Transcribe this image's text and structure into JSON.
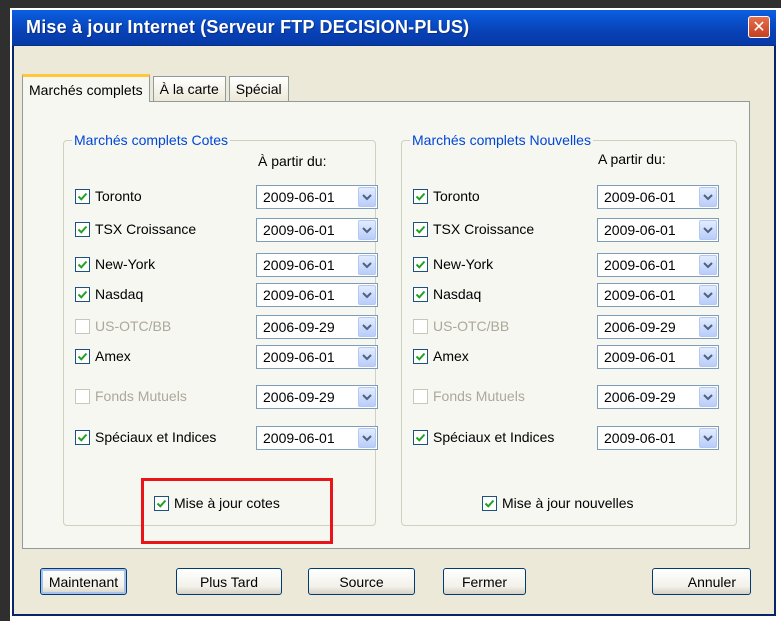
{
  "window": {
    "title": "Mise à jour Internet (Serveur FTP DECISION-PLUS)",
    "close_glyph": "✕"
  },
  "tabs": [
    {
      "label": "Marchés complets",
      "active": true
    },
    {
      "label": "À la carte",
      "active": false
    },
    {
      "label": "Spécial",
      "active": false
    }
  ],
  "cotes": {
    "group_title": "Marchés complets Cotes",
    "date_header": "À partir du:",
    "rows": [
      {
        "label": "Toronto",
        "checked": true,
        "enabled": true,
        "date": "2009-06-01"
      },
      {
        "label": "TSX Croissance",
        "checked": true,
        "enabled": true,
        "date": "2009-06-01"
      },
      {
        "label": "New-York",
        "checked": true,
        "enabled": true,
        "date": "2009-06-01"
      },
      {
        "label": "Nasdaq",
        "checked": true,
        "enabled": true,
        "date": "2009-06-01"
      },
      {
        "label": "US-OTC/BB",
        "checked": false,
        "enabled": false,
        "date": "2006-09-29"
      },
      {
        "label": "Amex",
        "checked": true,
        "enabled": true,
        "date": "2009-06-01"
      },
      {
        "label": "Fonds Mutuels",
        "checked": false,
        "enabled": false,
        "date": "2006-09-29"
      },
      {
        "label": "Spéciaux et Indices",
        "checked": true,
        "enabled": true,
        "date": "2009-06-01"
      }
    ],
    "update_label": "Mise à jour cotes",
    "update_checked": true
  },
  "nouvelles": {
    "group_title": "Marchés complets Nouvelles",
    "date_header": "A partir du:",
    "rows": [
      {
        "label": "Toronto",
        "checked": true,
        "enabled": true,
        "date": "2009-06-01"
      },
      {
        "label": "TSX Croissance",
        "checked": true,
        "enabled": true,
        "date": "2009-06-01"
      },
      {
        "label": "New-York",
        "checked": true,
        "enabled": true,
        "date": "2009-06-01"
      },
      {
        "label": "Nasdaq",
        "checked": true,
        "enabled": true,
        "date": "2009-06-01"
      },
      {
        "label": "US-OTC/BB",
        "checked": false,
        "enabled": false,
        "date": "2006-09-29"
      },
      {
        "label": "Amex",
        "checked": true,
        "enabled": true,
        "date": "2009-06-01"
      },
      {
        "label": "Fonds Mutuels",
        "checked": false,
        "enabled": false,
        "date": "2006-09-29"
      },
      {
        "label": "Spéciaux et Indices",
        "checked": true,
        "enabled": true,
        "date": "2009-06-01"
      }
    ],
    "update_label": "Mise à jour nouvelles",
    "update_checked": true
  },
  "buttons": {
    "maintenant": "Maintenant",
    "plus_tard": "Plus Tard",
    "source": "Source",
    "fermer": "Fermer",
    "annuler": "Annuler"
  },
  "colors": {
    "titlebar": "#0842B8",
    "group_title": "#0046D5",
    "highlight": "#E8141A",
    "dialog_bg": "#ECE9D8"
  },
  "icons": {
    "checkbox_mark": "checkmark-icon",
    "dropdown": "chevron-down-icon",
    "close": "close-icon"
  }
}
